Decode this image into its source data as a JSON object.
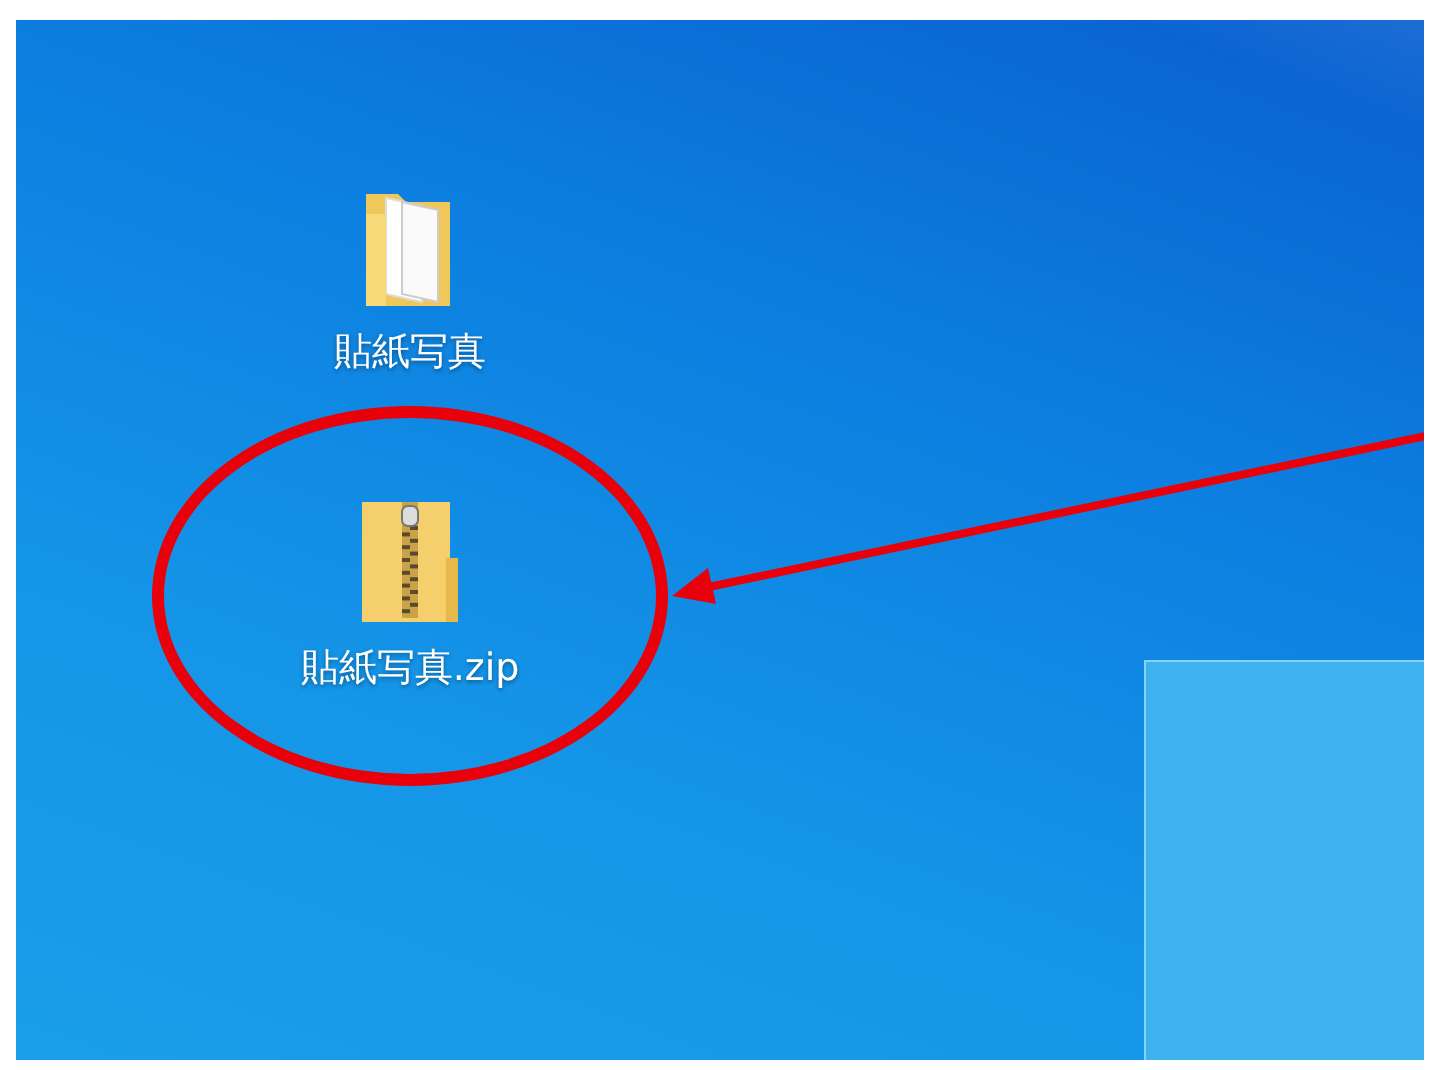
{
  "desktop": {
    "icons": [
      {
        "kind": "folder",
        "label": "貼紙写真",
        "highlighted": false
      },
      {
        "kind": "zip",
        "label": "貼紙写真.zip",
        "highlighted": true
      }
    ],
    "window_corner": true
  }
}
